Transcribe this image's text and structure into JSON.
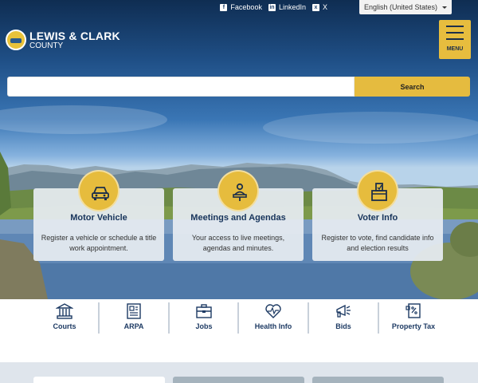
{
  "topbar": {
    "social": [
      {
        "label": "Facebook",
        "icon": "facebook-icon",
        "glyph": "f"
      },
      {
        "label": "LinkedIn",
        "icon": "linkedin-icon",
        "glyph": "in"
      },
      {
        "label": "X",
        "icon": "x-twitter-icon",
        "glyph": "x"
      }
    ],
    "language": "English (United States)"
  },
  "logo": {
    "line1": "LEWIS & CLARK",
    "line2": "COUNTY"
  },
  "menu": {
    "label": "MENU"
  },
  "search": {
    "placeholder": "",
    "button_label": "Search"
  },
  "cards": [
    {
      "title": "Motor Vehicle",
      "desc": "Register a vehicle or schedule a title work appointment.",
      "icon": "car-icon"
    },
    {
      "title": "Meetings and Agendas",
      "desc": "Your access to live meetings, agendas and minutes.",
      "icon": "podium-speaker-icon"
    },
    {
      "title": "Voter Info",
      "desc": "Register to vote, find candidate info and election results",
      "icon": "ballot-box-icon"
    }
  ],
  "quick_links": [
    {
      "label": "Courts",
      "icon": "courthouse-icon"
    },
    {
      "label": "ARPA",
      "icon": "document-icon"
    },
    {
      "label": "Jobs",
      "icon": "briefcase-icon"
    },
    {
      "label": "Health Info",
      "icon": "heartbeat-icon"
    },
    {
      "label": "Bids",
      "icon": "megaphone-icon"
    },
    {
      "label": "Property Tax",
      "icon": "tax-document-icon"
    }
  ],
  "colors": {
    "accent": "#e6bc3d",
    "navy": "#17345b",
    "band": "#dfe5ec"
  }
}
